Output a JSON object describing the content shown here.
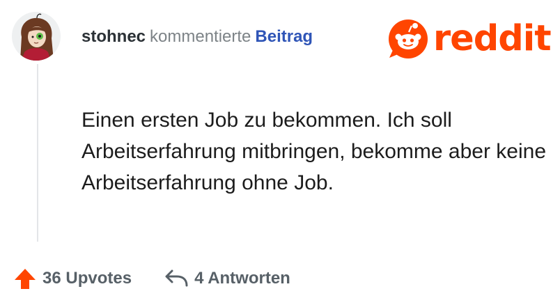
{
  "comment": {
    "username": "stohnec",
    "action": "kommentierte",
    "link_label": "Beitrag",
    "text": "Einen ersten Job zu bekommen. Ich soll Arbeitserfahrung mitbringen, bekomme aber keine Arbeitserfahrung ohne Job."
  },
  "brand": {
    "name": "reddit",
    "logo_icon": "reddit-snoo-icon",
    "color": "#ff4500"
  },
  "footer": {
    "upvotes_label": "36 Upvotes",
    "upvote_icon": "upvote-arrow-icon",
    "replies_label": "4 Antworten",
    "reply_icon": "reply-arrow-icon"
  },
  "colors": {
    "username": "#2b3136",
    "action_text": "#7d8387",
    "link": "#2f55b7",
    "upvote_arrow": "#ff4500",
    "footer_text": "#576067",
    "thread_line": "#e3e5e8"
  }
}
